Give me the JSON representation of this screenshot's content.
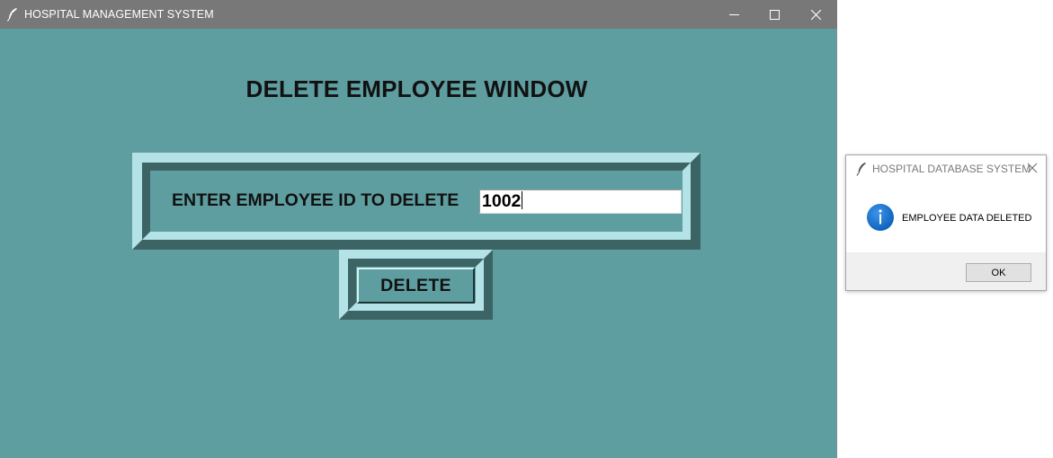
{
  "main_window": {
    "title": "HOSPITAL MANAGEMENT SYSTEM",
    "app_icon": "feather-icon",
    "controls": [
      "minimize-icon",
      "maximize-icon",
      "close-icon"
    ],
    "background_color": "#5f9ea0",
    "titlebar_color": "#787878"
  },
  "form": {
    "heading": "DELETE EMPLOYEE WINDOW",
    "prompt_label": "ENTER EMPLOYEE ID TO DELETE",
    "employee_id_value": "1002",
    "delete_button_label": "DELETE",
    "frame_light_color": "#b3e3e6",
    "frame_dark_color": "#3d6465"
  },
  "dialog": {
    "title": "HOSPITAL DATABASE SYSTEM",
    "title_icon": "feather-icon",
    "icon": "info-icon",
    "message": "EMPLOYEE DATA DELETED",
    "ok_label": "OK",
    "info_icon_color": "#0a67c8"
  }
}
